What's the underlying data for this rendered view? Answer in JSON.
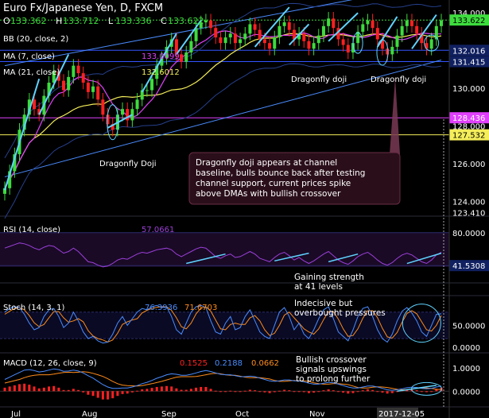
{
  "header": {
    "title": "Euro Fx/Japanese Yen, D, FXCM",
    "ohlc": [
      {
        "k": "O",
        "v": "133.362"
      },
      {
        "k": "H",
        "v": "133.712"
      },
      {
        "k": "L",
        "v": "133.336"
      },
      {
        "k": "C",
        "v": "133.622"
      }
    ]
  },
  "indicators": {
    "bb": {
      "label": "BB (20, close, 2)"
    },
    "ma7": {
      "label": "MA (7, close)",
      "value": "133.0099",
      "color": "#e040fb"
    },
    "ma21": {
      "label": "MA (21, close)",
      "value": "132.6012",
      "color": "#f4ee5a"
    }
  },
  "colors": {
    "up": "#3ddc3d",
    "down": "#ff2020",
    "channel": "#4a8cff",
    "ma7": "#e040fb",
    "ma21": "#f4ee5a",
    "annotation_arrow": "#5fd3ff",
    "callout_bg": "#2a0f1a"
  },
  "price_axis": {
    "ticks": [
      {
        "value": 134.0,
        "label": "134.000"
      },
      {
        "value": 132.0,
        "label": "132.000"
      },
      {
        "value": 130.0,
        "label": "130.000"
      },
      {
        "value": 128.0,
        "label": "128.000"
      },
      {
        "value": 126.0,
        "label": "126.000"
      },
      {
        "value": 124.0,
        "label": "124.000"
      },
      {
        "value": 123.4,
        "label": "123.410"
      }
    ],
    "ylim": [
      123.3,
      134.6
    ],
    "markers": [
      {
        "value": 133.622,
        "label": "133.622",
        "bg": "#3ddc3d",
        "fg": "#000"
      },
      {
        "value": 132.016,
        "label": "132.016",
        "bg": "#102060",
        "fg": "#fff"
      },
      {
        "value": 131.415,
        "label": "131.415",
        "bg": "#102060",
        "fg": "#fff"
      },
      {
        "value": 128.436,
        "label": "128.436",
        "bg": "#e040fb",
        "fg": "#fff"
      },
      {
        "value": 127.532,
        "label": "127.532",
        "bg": "#f4ee5a",
        "fg": "#000"
      }
    ],
    "hlines": [
      {
        "value": 133.622,
        "color": "#3ddc3d",
        "dash": true
      },
      {
        "value": 132.016,
        "color": "#3355ff",
        "dash": false
      },
      {
        "value": 131.415,
        "color": "#3355ff",
        "dash": false
      },
      {
        "value": 128.436,
        "color": "#e040fb",
        "dash": false
      },
      {
        "value": 127.532,
        "color": "#f4ee5a",
        "dash": false
      }
    ]
  },
  "x_axis": {
    "labels": [
      "Jul",
      "Aug",
      "Sep",
      "Oct",
      "Nov"
    ],
    "current_date": "2017-12-05"
  },
  "annotations": {
    "dragonfly_doji_1": "Dragonfly Doji",
    "dragonfly_doji_2": "Dragonfly doji",
    "dragonfly_doji_3": "Dragonfly doji",
    "callout": [
      "Dragonfly doji appears at  channel",
      "baseline, bulls bounce back after testing",
      "channel support, current prices spike",
      "above DMAs with bullish crossover"
    ]
  },
  "rsi": {
    "label": "RSI (14, close)",
    "value": "57.0661",
    "ticks": [
      {
        "value": 80,
        "label": "80.0000"
      }
    ],
    "marker": {
      "value": 41.5308,
      "label": "41.5308"
    },
    "ylim": [
      25,
      90
    ],
    "note": [
      "Gaining strength",
      "at 41 levels"
    ]
  },
  "stoch": {
    "label": "Stoch (14, 3, 1)",
    "k_value": "76.3936",
    "d_value": "71.6703",
    "k_color": "#4a8cff",
    "d_color": "#ff8c1a",
    "ticks": [
      {
        "value": 50,
        "label": "50.0000"
      },
      {
        "value": 0,
        "label": "0.0000"
      }
    ],
    "ylim": [
      -5,
      110
    ],
    "note": [
      "Indecisive but",
      "overbought pressures"
    ]
  },
  "macd": {
    "label": "MACD (12, 26, close, 9)",
    "hist_value": "0.1525",
    "macd_value": "0.2188",
    "signal_value": "0.0662",
    "hist_color": "#ff2020",
    "macd_color": "#4a8cff",
    "signal_color": "#ff8c1a",
    "ticks": [
      {
        "value": 1.0,
        "label": "1.0000"
      },
      {
        "value": 0.0,
        "label": "0.0000"
      }
    ],
    "ylim": [
      -0.6,
      1.5
    ],
    "note": [
      "Bullish crossover",
      "signals upswings",
      "to prolong further"
    ]
  },
  "chart_data": {
    "type": "candlestick",
    "title": "Euro Fx/Japanese Yen, D, FXCM",
    "x_start": "2017-06-28",
    "x_end": "2017-12-05",
    "ylim": [
      123.3,
      134.6
    ],
    "close": [
      124.7,
      125.6,
      126.5,
      127.8,
      128.6,
      129.4,
      128.9,
      128.6,
      129.6,
      130.3,
      130.9,
      130.4,
      129.9,
      130.6,
      131.2,
      130.8,
      130.3,
      129.8,
      130.1,
      129.4,
      128.6,
      128.1,
      127.8,
      128.6,
      128.9,
      128.3,
      128.9,
      129.4,
      129.9,
      129.9,
      130.5,
      131.2,
      131.6,
      132.2,
      132.6,
      131.8,
      131.4,
      131.9,
      132.5,
      133.2,
      133.5,
      133.6,
      133.2,
      132.7,
      132.4,
      132.7,
      132.9,
      132.4,
      132.6,
      132.9,
      133.4,
      133.1,
      132.6,
      132.4,
      132.1,
      132.7,
      133.3,
      133.5,
      133.1,
      132.6,
      132.9,
      132.5,
      132.1,
      132.4,
      132.8,
      133.3,
      133.7,
      133.2,
      132.6,
      132.3,
      131.9,
      132.4,
      133.0,
      133.4,
      133.6,
      133.2,
      132.6,
      132.1,
      131.8,
      132.2,
      132.8,
      133.3,
      133.6,
      133.3,
      132.9,
      132.4,
      132.1,
      132.6,
      133.3,
      133.6
    ],
    "rsi": [
      62,
      64,
      66,
      68,
      67,
      65,
      62,
      60,
      63,
      65,
      64,
      60,
      56,
      58,
      62,
      58,
      52,
      46,
      45,
      42,
      40,
      41,
      44,
      48,
      50,
      49,
      52,
      55,
      57,
      56,
      58,
      60,
      61,
      62,
      60,
      55,
      52,
      55,
      58,
      61,
      63,
      62,
      57,
      52,
      50,
      53,
      55,
      51,
      52,
      55,
      58,
      55,
      50,
      48,
      46,
      51,
      55,
      57,
      53,
      48,
      51,
      47,
      44,
      47,
      51,
      55,
      58,
      53,
      48,
      45,
      43,
      47,
      52,
      55,
      57,
      53,
      48,
      44,
      42,
      45,
      50,
      54,
      56,
      54,
      50,
      46,
      44,
      48,
      54,
      57
    ],
    "stoch_k": [
      80,
      88,
      92,
      90,
      75,
      55,
      40,
      45,
      70,
      85,
      88,
      70,
      45,
      55,
      80,
      60,
      35,
      20,
      25,
      15,
      10,
      12,
      30,
      55,
      70,
      50,
      65,
      80,
      88,
      85,
      92,
      95,
      90,
      92,
      70,
      40,
      30,
      55,
      80,
      92,
      95,
      90,
      60,
      35,
      30,
      55,
      70,
      40,
      45,
      70,
      85,
      60,
      35,
      25,
      20,
      50,
      80,
      90,
      70,
      40,
      55,
      30,
      20,
      40,
      65,
      85,
      92,
      65,
      35,
      25,
      15,
      40,
      70,
      88,
      92,
      70,
      40,
      20,
      12,
      30,
      60,
      82,
      90,
      78,
      60,
      35,
      25,
      50,
      75,
      76
    ],
    "stoch_d": [
      75,
      82,
      88,
      90,
      85,
      72,
      56,
      47,
      52,
      67,
      81,
      81,
      67,
      57,
      60,
      65,
      58,
      38,
      26,
      20,
      17,
      12,
      17,
      32,
      52,
      58,
      62,
      65,
      78,
      84,
      88,
      91,
      92,
      92,
      84,
      67,
      47,
      42,
      55,
      76,
      89,
      92,
      82,
      62,
      42,
      40,
      52,
      55,
      52,
      52,
      67,
      72,
      60,
      40,
      27,
      32,
      50,
      73,
      80,
      67,
      55,
      42,
      35,
      30,
      42,
      63,
      81,
      81,
      64,
      42,
      25,
      27,
      42,
      66,
      83,
      83,
      67,
      43,
      24,
      21,
      34,
      57,
      77,
      83,
      76,
      58,
      40,
      37,
      50,
      72
    ],
    "macd_hist": [
      0.15,
      0.2,
      0.25,
      0.3,
      0.32,
      0.28,
      0.2,
      0.12,
      0.15,
      0.2,
      0.22,
      0.15,
      0.05,
      0.05,
      0.1,
      0.05,
      -0.05,
      -0.15,
      -0.2,
      -0.28,
      -0.35,
      -0.35,
      -0.3,
      -0.2,
      -0.12,
      -0.1,
      -0.05,
      0.02,
      0.08,
      0.1,
      0.14,
      0.18,
      0.2,
      0.22,
      0.2,
      0.12,
      0.06,
      0.06,
      0.1,
      0.15,
      0.18,
      0.18,
      0.1,
      0.02,
      -0.02,
      0.0,
      0.02,
      -0.02,
      -0.02,
      0.02,
      0.06,
      0.04,
      -0.02,
      -0.05,
      -0.08,
      -0.04,
      0.02,
      0.06,
      0.04,
      -0.02,
      0.0,
      -0.04,
      -0.08,
      -0.06,
      -0.02,
      0.04,
      0.08,
      0.04,
      -0.02,
      -0.06,
      -0.1,
      -0.08,
      -0.02,
      0.04,
      0.08,
      0.05,
      -0.01,
      -0.06,
      -0.1,
      -0.08,
      -0.02,
      0.04,
      0.08,
      0.07,
      0.04,
      -0.01,
      -0.04,
      0.0,
      0.1,
      0.15
    ],
    "macd_line": [
      0.5,
      0.6,
      0.7,
      0.8,
      0.9,
      0.92,
      0.88,
      0.82,
      0.85,
      0.9,
      0.95,
      0.92,
      0.85,
      0.86,
      0.9,
      0.86,
      0.78,
      0.66,
      0.56,
      0.42,
      0.28,
      0.18,
      0.12,
      0.12,
      0.14,
      0.14,
      0.18,
      0.24,
      0.32,
      0.38,
      0.46,
      0.55,
      0.62,
      0.7,
      0.74,
      0.72,
      0.68,
      0.68,
      0.72,
      0.78,
      0.84,
      0.88,
      0.84,
      0.78,
      0.72,
      0.7,
      0.7,
      0.66,
      0.62,
      0.62,
      0.64,
      0.62,
      0.56,
      0.5,
      0.44,
      0.42,
      0.44,
      0.48,
      0.48,
      0.44,
      0.44,
      0.4,
      0.34,
      0.3,
      0.3,
      0.34,
      0.38,
      0.36,
      0.3,
      0.24,
      0.18,
      0.14,
      0.14,
      0.18,
      0.22,
      0.22,
      0.18,
      0.12,
      0.06,
      0.04,
      0.06,
      0.1,
      0.15,
      0.17,
      0.16,
      0.12,
      0.1,
      0.12,
      0.18,
      0.22
    ],
    "macd_signal": [
      0.35,
      0.4,
      0.45,
      0.5,
      0.58,
      0.64,
      0.68,
      0.7,
      0.7,
      0.7,
      0.73,
      0.77,
      0.8,
      0.81,
      0.8,
      0.81,
      0.83,
      0.81,
      0.76,
      0.7,
      0.63,
      0.53,
      0.42,
      0.32,
      0.26,
      0.24,
      0.23,
      0.22,
      0.24,
      0.28,
      0.32,
      0.37,
      0.42,
      0.48,
      0.54,
      0.6,
      0.62,
      0.62,
      0.62,
      0.63,
      0.66,
      0.7,
      0.74,
      0.76,
      0.74,
      0.7,
      0.68,
      0.68,
      0.64,
      0.6,
      0.58,
      0.58,
      0.58,
      0.55,
      0.52,
      0.46,
      0.42,
      0.42,
      0.44,
      0.46,
      0.44,
      0.44,
      0.42,
      0.36,
      0.32,
      0.3,
      0.3,
      0.32,
      0.32,
      0.3,
      0.28,
      0.22,
      0.16,
      0.14,
      0.14,
      0.17,
      0.19,
      0.18,
      0.16,
      0.12,
      0.08,
      0.06,
      0.07,
      0.1,
      0.12,
      0.13,
      0.14,
      0.12,
      0.08,
      0.07
    ]
  }
}
